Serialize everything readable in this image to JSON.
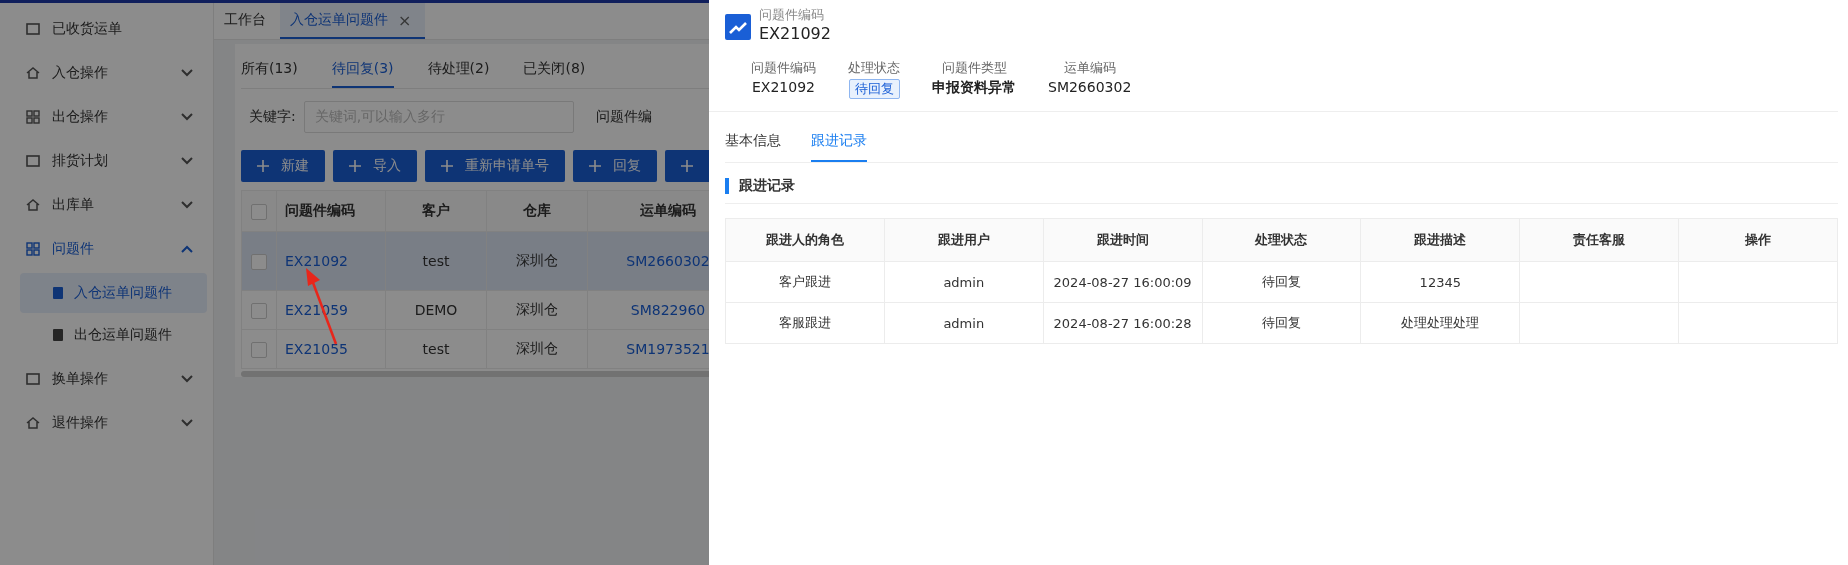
{
  "sidebar": {
    "items": [
      {
        "label": "已收货运单",
        "kind": "link",
        "expanded": false
      },
      {
        "label": "入仓操作",
        "kind": "group",
        "expanded": false
      },
      {
        "label": "出仓操作",
        "kind": "group",
        "expanded": false
      },
      {
        "label": "排货计划",
        "kind": "group",
        "expanded": false
      },
      {
        "label": "出库单",
        "kind": "group",
        "expanded": false
      },
      {
        "label": "问题件",
        "kind": "group",
        "expanded": true,
        "children": [
          {
            "label": "入仓运单问题件",
            "selected": true
          },
          {
            "label": "出仓运单问题件",
            "selected": false
          }
        ]
      },
      {
        "label": "换单操作",
        "kind": "group",
        "expanded": false
      },
      {
        "label": "退件操作",
        "kind": "group",
        "expanded": false
      }
    ]
  },
  "page_tabs": [
    {
      "label": "工作台",
      "selected": false,
      "closable": false
    },
    {
      "label": "入仓运单问题件",
      "selected": true,
      "closable": true,
      "close": "×"
    }
  ],
  "status_tabs": [
    {
      "label": "所有(13)",
      "selected": false
    },
    {
      "label": "待回复(3)",
      "selected": true
    },
    {
      "label": "待处理(2)",
      "selected": false
    },
    {
      "label": "已关闭(8)",
      "selected": false
    }
  ],
  "filters": {
    "keyword_label": "关键字:",
    "keyword_placeholder": "关键词,可以输入多行",
    "next_label": "问题件编"
  },
  "actions": [
    "新建",
    "导入",
    "重新申请单号",
    "回复"
  ],
  "table": {
    "all_checked": false,
    "columns": [
      "问题件编码",
      "客户",
      "仓库",
      "运单编码"
    ],
    "rows": [
      {
        "selected": true,
        "checked": false,
        "cells": [
          "EX21092",
          "test",
          "深圳仓",
          "SM2660302"
        ]
      },
      {
        "selected": false,
        "checked": false,
        "cells": [
          "EX21059",
          "DEMO",
          "深圳仓",
          "SM822960"
        ]
      },
      {
        "selected": false,
        "checked": false,
        "cells": [
          "EX21055",
          "test",
          "深圳仓",
          "SM1973521"
        ]
      }
    ]
  },
  "drawer": {
    "caption": "问题件编码",
    "title": "EX21092",
    "fields": [
      {
        "label": "问题件编码",
        "value": "EX21092",
        "kind": "text"
      },
      {
        "label": "处理状态",
        "value": "待回复",
        "kind": "tag"
      },
      {
        "label": "问题件类型",
        "value": "申报资料异常",
        "kind": "bold"
      },
      {
        "label": "运单编码",
        "value": "SM2660302",
        "kind": "text"
      }
    ],
    "tabs": [
      {
        "label": "基本信息",
        "selected": false
      },
      {
        "label": "跟进记录",
        "selected": true
      }
    ],
    "section_title": "跟进记录",
    "table": {
      "columns": [
        "跟进人的角色",
        "跟进用户",
        "跟进时间",
        "处理状态",
        "跟进描述",
        "责任客服",
        "操作"
      ],
      "rows": [
        [
          "客户跟进",
          "admin",
          "2024-08-27 16:00:09",
          "待回复",
          "12345",
          "",
          ""
        ],
        [
          "客服跟进",
          "admin",
          "2024-08-27 16:00:28",
          "待回复",
          "处理处理处理",
          "",
          ""
        ]
      ]
    }
  }
}
